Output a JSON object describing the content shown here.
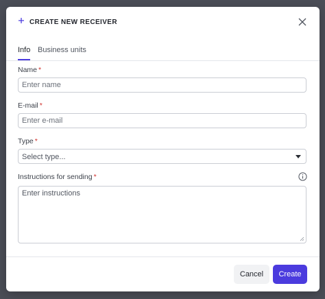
{
  "dialog": {
    "title": "CREATE NEW RECEIVER"
  },
  "tabs": [
    {
      "label": "Info",
      "active": true
    },
    {
      "label": "Business units",
      "active": false
    }
  ],
  "fields": {
    "name": {
      "label": "Name",
      "required_mark": "*",
      "placeholder": "Enter name",
      "value": ""
    },
    "email": {
      "label": "E-mail",
      "required_mark": "*",
      "placeholder": "Enter e-mail",
      "value": ""
    },
    "type": {
      "label": "Type",
      "required_mark": "*",
      "selected": "Select type..."
    },
    "instructions": {
      "label": "Instructions for sending",
      "required_mark": "*",
      "placeholder": "Enter instructions",
      "value": ""
    }
  },
  "footer": {
    "cancel_label": "Cancel",
    "create_label": "Create"
  },
  "colors": {
    "accent": "#4b3bde",
    "required": "#d0312d",
    "overlay": "#4b4e57"
  },
  "icons": {
    "header": "plus-icon",
    "close": "close-icon",
    "info": "info-icon",
    "select": "chevron-down-icon"
  }
}
